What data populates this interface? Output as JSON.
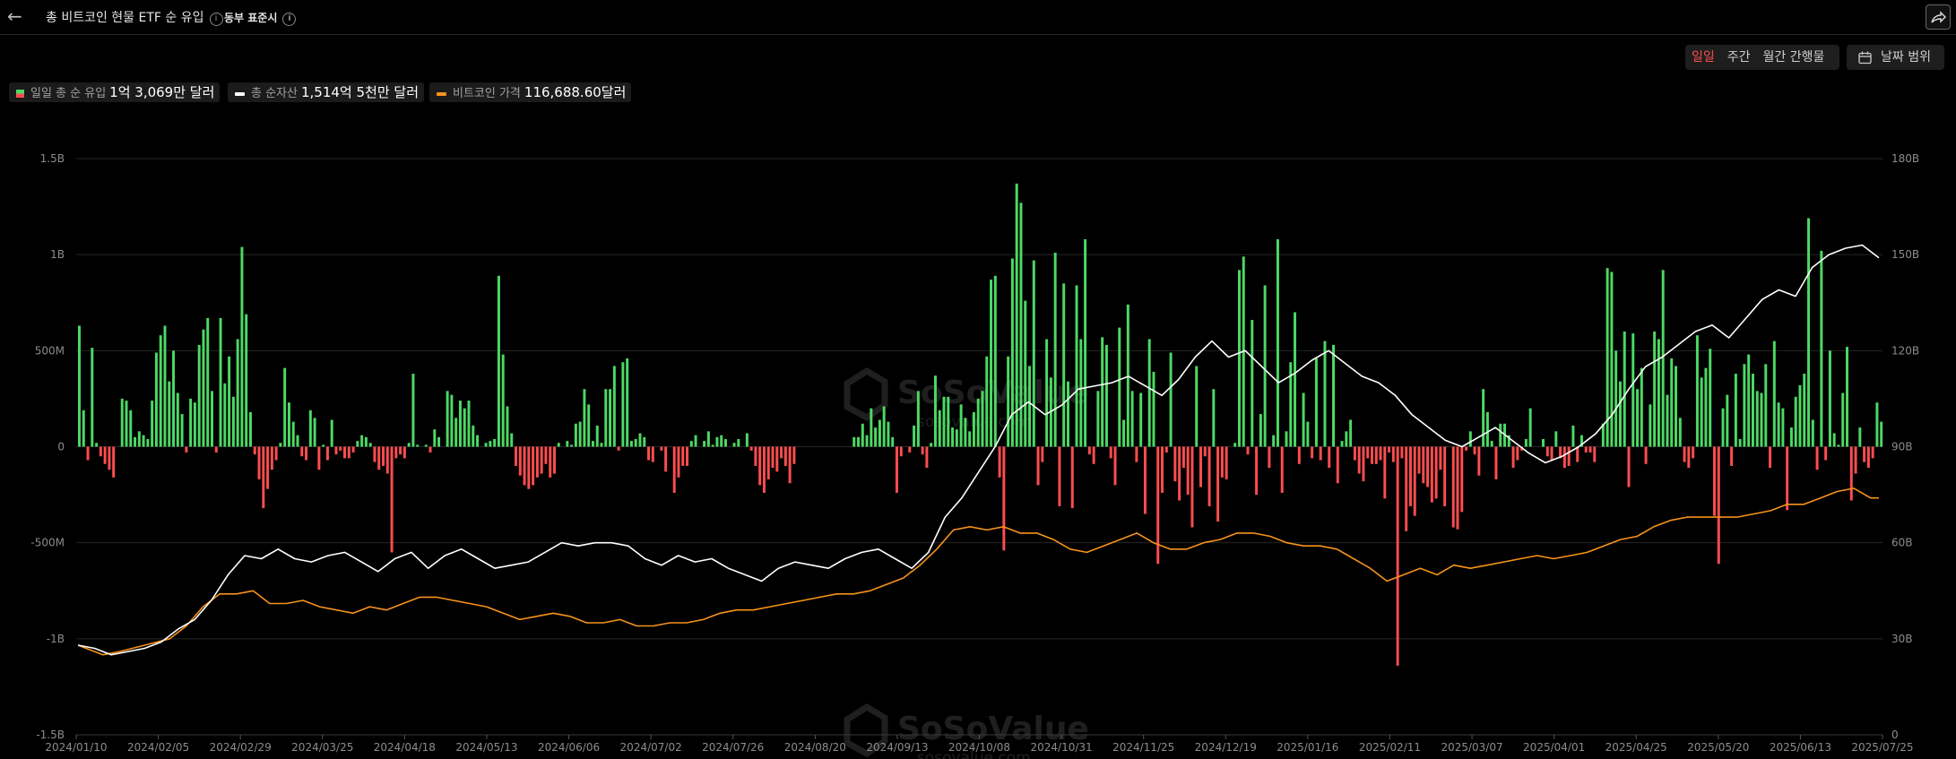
{
  "header": {
    "title": "총 비트코인 현물 ETF 순 유입",
    "timezone": "동부 표준시",
    "info_icon": "info-icon",
    "back_icon": "arrow-left-icon",
    "share_icon": "share-icon"
  },
  "controls": {
    "period_tabs": [
      {
        "label": "일일",
        "active": true
      },
      {
        "label": "주간",
        "active": false
      },
      {
        "label": "월간 간행물",
        "active": false
      }
    ],
    "date_range_label": "날짜 범위",
    "date_range_icon": "calendar-icon"
  },
  "legend": [
    {
      "label": "일일 총 순 유입",
      "value": "1억 3,069만 달러",
      "icon": "red-green-square-icon"
    },
    {
      "label": "총 순자산",
      "value": "1,514억 5천만 달러",
      "color": "#ffffff"
    },
    {
      "label": "비트코인 가격",
      "value": "116,688.60달러",
      "color": "#f7931a"
    }
  ],
  "watermark": {
    "brand": "SoSoValue",
    "url": "sosovalue.com"
  },
  "chart_data": {
    "type": "bar+line",
    "colors": {
      "positive": "#4cd964",
      "negative": "#ff4d4f",
      "net_assets": "#ffffff",
      "btc_price": "#f7931a"
    },
    "left_axis": {
      "ticks": [
        "1.5B",
        "1B",
        "500M",
        "0",
        "-500M",
        "-1B",
        "-1.5B"
      ],
      "range": [
        -1.5,
        1.5
      ],
      "unit": "B"
    },
    "right_axis": {
      "ticks": [
        "180B",
        "150B",
        "120B",
        "90B",
        "60B",
        "30B",
        "0"
      ],
      "range": [
        0,
        180
      ],
      "unit": "B"
    },
    "x_ticks": [
      "2024/01/10",
      "2024/02/05",
      "2024/02/29",
      "2024/03/25",
      "2024/04/18",
      "2024/05/13",
      "2024/06/06",
      "2024/07/02",
      "2024/07/26",
      "2024/08/20",
      "2024/09/13",
      "2024/10/08",
      "2024/10/31",
      "2024/11/25",
      "2024/12/19",
      "2025/01/16",
      "2025/02/11",
      "2025/03/07",
      "2025/04/01",
      "2025/04/25",
      "2025/05/20",
      "2025/06/13",
      "2025/07/25"
    ],
    "daily_net_inflow_M": [
      630,
      190,
      -70,
      515,
      20,
      -50,
      -90,
      -120,
      -160,
      0,
      250,
      240,
      190,
      50,
      80,
      60,
      40,
      240,
      490,
      580,
      630,
      340,
      500,
      280,
      170,
      -30,
      250,
      230,
      530,
      610,
      670,
      290,
      -30,
      670,
      330,
      470,
      260,
      560,
      1040,
      690,
      180,
      -40,
      -170,
      -320,
      -220,
      -120,
      -70,
      20,
      410,
      230,
      130,
      60,
      -50,
      -70,
      190,
      150,
      -120,
      10,
      -70,
      140,
      -40,
      -20,
      -60,
      -60,
      -30,
      30,
      60,
      50,
      20,
      -80,
      -120,
      -100,
      -140,
      -550,
      -60,
      -40,
      -60,
      20,
      380,
      10,
      0,
      10,
      -30,
      90,
      50,
      0,
      290,
      270,
      150,
      240,
      200,
      240,
      110,
      60,
      0,
      20,
      30,
      40,
      890,
      480,
      210,
      70,
      -100,
      -150,
      -200,
      -220,
      -200,
      -160,
      -140,
      -90,
      -160,
      -140,
      20,
      0,
      30,
      10,
      120,
      130,
      300,
      220,
      30,
      110,
      20,
      300,
      300,
      420,
      -20,
      440,
      460,
      30,
      40,
      70,
      50,
      -70,
      -80,
      0,
      -20,
      -130,
      0,
      -240,
      -160,
      -100,
      -100,
      30,
      60,
      0,
      30,
      80,
      10,
      50,
      60,
      40,
      0,
      20,
      40,
      0,
      70,
      -20,
      -100,
      -200,
      -240,
      -170,
      -110,
      -130,
      -60,
      -100,
      -190,
      -90,
      0,
      0,
      0,
      0,
      0,
      0,
      0,
      0,
      0,
      0,
      0,
      0,
      0,
      50,
      50,
      120,
      60,
      200,
      100,
      140,
      210,
      130,
      50,
      -240,
      -50,
      0,
      -30,
      110,
      290,
      -40,
      -110,
      20,
      370,
      190,
      260,
      260,
      100,
      90,
      220,
      150,
      80,
      180,
      250,
      290,
      470,
      870,
      890,
      -160,
      -540,
      470,
      980,
      1370,
      1270,
      760,
      420,
      970,
      -200,
      -80,
      560,
      360,
      1010,
      -310,
      850,
      340,
      -320,
      840,
      560,
      1080,
      -40,
      -90,
      290,
      570,
      530,
      -60,
      -200,
      620,
      140,
      740,
      290,
      -80,
      280,
      -350,
      560,
      390,
      -610,
      -240,
      -30,
      490,
      -180,
      -280,
      -110,
      -250,
      -420,
      420,
      -210,
      -50,
      -310,
      300,
      -390,
      -160,
      -170,
      0,
      20,
      920,
      990,
      -40,
      660,
      -250,
      170,
      840,
      -110,
      60,
      1080,
      -240,
      80,
      440,
      700,
      -90,
      280,
      130,
      -60,
      460,
      -70,
      550,
      -110,
      530,
      -190,
      30,
      80,
      140,
      -70,
      -140,
      -180,
      -60,
      -90,
      -90,
      -70,
      -270,
      -30,
      -80,
      -1140,
      -60,
      -440,
      -310,
      -360,
      -140,
      -190,
      -210,
      -290,
      -270,
      -120,
      -310,
      0,
      -420,
      -430,
      -340,
      -20,
      80,
      -40,
      -150,
      300,
      180,
      30,
      -170,
      120,
      120,
      60,
      -110,
      -70,
      -20,
      40,
      200,
      0,
      0,
      40,
      -50,
      -70,
      80,
      -60,
      -110,
      -100,
      110,
      -80,
      60,
      -30,
      -30,
      -80,
      0,
      120,
      930,
      910,
      500,
      340,
      600,
      -210,
      590,
      300,
      410,
      -90,
      220,
      600,
      560,
      920,
      270,
      460,
      420,
      150,
      -80,
      -110,
      -60,
      580,
      360,
      410,
      510,
      -360,
      -610,
      200,
      270,
      -100,
      380,
      40,
      430,
      480,
      380,
      290,
      280,
      430,
      -110,
      550,
      230,
      200,
      -330,
      100,
      260,
      320,
      380,
      1190,
      140,
      -120,
      1020,
      -70,
      500,
      70,
      10,
      280,
      520,
      -280,
      -140,
      100,
      -80,
      -110,
      -60,
      230,
      130
    ],
    "total_net_assets_B": [
      [
        0,
        28
      ],
      [
        4,
        27
      ],
      [
        8,
        25
      ],
      [
        12,
        26
      ],
      [
        16,
        27
      ],
      [
        20,
        29
      ],
      [
        24,
        33
      ],
      [
        28,
        36
      ],
      [
        32,
        42
      ],
      [
        36,
        50
      ],
      [
        40,
        56
      ],
      [
        44,
        55
      ],
      [
        48,
        58
      ],
      [
        52,
        55
      ],
      [
        56,
        54
      ],
      [
        60,
        56
      ],
      [
        64,
        57
      ],
      [
        68,
        54
      ],
      [
        72,
        51
      ],
      [
        76,
        55
      ],
      [
        80,
        57
      ],
      [
        84,
        52
      ],
      [
        88,
        56
      ],
      [
        92,
        58
      ],
      [
        96,
        55
      ],
      [
        100,
        52
      ],
      [
        104,
        53
      ],
      [
        108,
        54
      ],
      [
        112,
        57
      ],
      [
        116,
        60
      ],
      [
        120,
        59
      ],
      [
        124,
        60
      ],
      [
        128,
        60
      ],
      [
        132,
        59
      ],
      [
        136,
        55
      ],
      [
        140,
        53
      ],
      [
        144,
        56
      ],
      [
        148,
        54
      ],
      [
        152,
        55
      ],
      [
        156,
        52
      ],
      [
        160,
        50
      ],
      [
        164,
        48
      ],
      [
        168,
        52
      ],
      [
        172,
        54
      ],
      [
        176,
        53
      ],
      [
        180,
        52
      ],
      [
        184,
        55
      ],
      [
        188,
        57
      ],
      [
        192,
        58
      ],
      [
        196,
        55
      ],
      [
        200,
        52
      ],
      [
        204,
        57
      ],
      [
        208,
        68
      ],
      [
        212,
        74
      ],
      [
        216,
        82
      ],
      [
        220,
        90
      ],
      [
        224,
        100
      ],
      [
        228,
        104
      ],
      [
        232,
        100
      ],
      [
        236,
        103
      ],
      [
        240,
        108
      ],
      [
        244,
        109
      ],
      [
        248,
        110
      ],
      [
        252,
        112
      ],
      [
        256,
        109
      ],
      [
        260,
        106
      ],
      [
        264,
        111
      ],
      [
        268,
        118
      ],
      [
        272,
        123
      ],
      [
        276,
        118
      ],
      [
        280,
        120
      ],
      [
        284,
        115
      ],
      [
        288,
        110
      ],
      [
        292,
        113
      ],
      [
        296,
        117
      ],
      [
        300,
        120
      ],
      [
        304,
        116
      ],
      [
        308,
        112
      ],
      [
        312,
        110
      ],
      [
        316,
        106
      ],
      [
        320,
        100
      ],
      [
        324,
        96
      ],
      [
        328,
        92
      ],
      [
        332,
        90
      ],
      [
        336,
        93
      ],
      [
        340,
        96
      ],
      [
        344,
        92
      ],
      [
        348,
        88
      ],
      [
        352,
        85
      ],
      [
        356,
        87
      ],
      [
        360,
        90
      ],
      [
        364,
        94
      ],
      [
        368,
        100
      ],
      [
        372,
        108
      ],
      [
        376,
        115
      ],
      [
        380,
        118
      ],
      [
        384,
        122
      ],
      [
        388,
        126
      ],
      [
        392,
        128
      ],
      [
        396,
        124
      ],
      [
        400,
        130
      ],
      [
        404,
        136
      ],
      [
        408,
        139
      ],
      [
        412,
        137
      ],
      [
        416,
        146
      ],
      [
        420,
        150
      ],
      [
        424,
        152
      ],
      [
        428,
        153
      ],
      [
        432,
        149
      ]
    ],
    "btc_price_B": [
      [
        0,
        28
      ],
      [
        6,
        25
      ],
      [
        10,
        26
      ],
      [
        16,
        28
      ],
      [
        22,
        30
      ],
      [
        26,
        34
      ],
      [
        30,
        40
      ],
      [
        34,
        44
      ],
      [
        38,
        44
      ],
      [
        42,
        45
      ],
      [
        46,
        41
      ],
      [
        50,
        41
      ],
      [
        54,
        42
      ],
      [
        58,
        40
      ],
      [
        62,
        39
      ],
      [
        66,
        38
      ],
      [
        70,
        40
      ],
      [
        74,
        39
      ],
      [
        78,
        41
      ],
      [
        82,
        43
      ],
      [
        86,
        43
      ],
      [
        90,
        42
      ],
      [
        94,
        41
      ],
      [
        98,
        40
      ],
      [
        102,
        38
      ],
      [
        106,
        36
      ],
      [
        110,
        37
      ],
      [
        114,
        38
      ],
      [
        118,
        37
      ],
      [
        122,
        35
      ],
      [
        126,
        35
      ],
      [
        130,
        36
      ],
      [
        134,
        34
      ],
      [
        138,
        34
      ],
      [
        142,
        35
      ],
      [
        146,
        35
      ],
      [
        150,
        36
      ],
      [
        154,
        38
      ],
      [
        158,
        39
      ],
      [
        162,
        39
      ],
      [
        166,
        40
      ],
      [
        170,
        41
      ],
      [
        174,
        42
      ],
      [
        178,
        43
      ],
      [
        182,
        44
      ],
      [
        186,
        44
      ],
      [
        190,
        45
      ],
      [
        194,
        47
      ],
      [
        198,
        49
      ],
      [
        202,
        53
      ],
      [
        206,
        58
      ],
      [
        210,
        64
      ],
      [
        214,
        65
      ],
      [
        218,
        64
      ],
      [
        222,
        65
      ],
      [
        226,
        63
      ],
      [
        230,
        63
      ],
      [
        234,
        61
      ],
      [
        238,
        58
      ],
      [
        242,
        57
      ],
      [
        246,
        59
      ],
      [
        250,
        61
      ],
      [
        254,
        63
      ],
      [
        258,
        60
      ],
      [
        262,
        58
      ],
      [
        266,
        58
      ],
      [
        270,
        60
      ],
      [
        274,
        61
      ],
      [
        278,
        63
      ],
      [
        282,
        63
      ],
      [
        286,
        62
      ],
      [
        290,
        60
      ],
      [
        294,
        59
      ],
      [
        298,
        59
      ],
      [
        302,
        58
      ],
      [
        306,
        55
      ],
      [
        310,
        52
      ],
      [
        314,
        48
      ],
      [
        318,
        50
      ],
      [
        322,
        52
      ],
      [
        326,
        50
      ],
      [
        330,
        53
      ],
      [
        334,
        52
      ],
      [
        338,
        53
      ],
      [
        342,
        54
      ],
      [
        346,
        55
      ],
      [
        350,
        56
      ],
      [
        354,
        55
      ],
      [
        358,
        56
      ],
      [
        362,
        57
      ],
      [
        366,
        59
      ],
      [
        370,
        61
      ],
      [
        374,
        62
      ],
      [
        378,
        65
      ],
      [
        382,
        67
      ],
      [
        386,
        68
      ],
      [
        390,
        68
      ],
      [
        394,
        68
      ],
      [
        398,
        68
      ],
      [
        402,
        69
      ],
      [
        406,
        70
      ],
      [
        410,
        72
      ],
      [
        414,
        72
      ],
      [
        418,
        74
      ],
      [
        422,
        76
      ],
      [
        426,
        77
      ],
      [
        430,
        74
      ],
      [
        432,
        74
      ]
    ]
  }
}
